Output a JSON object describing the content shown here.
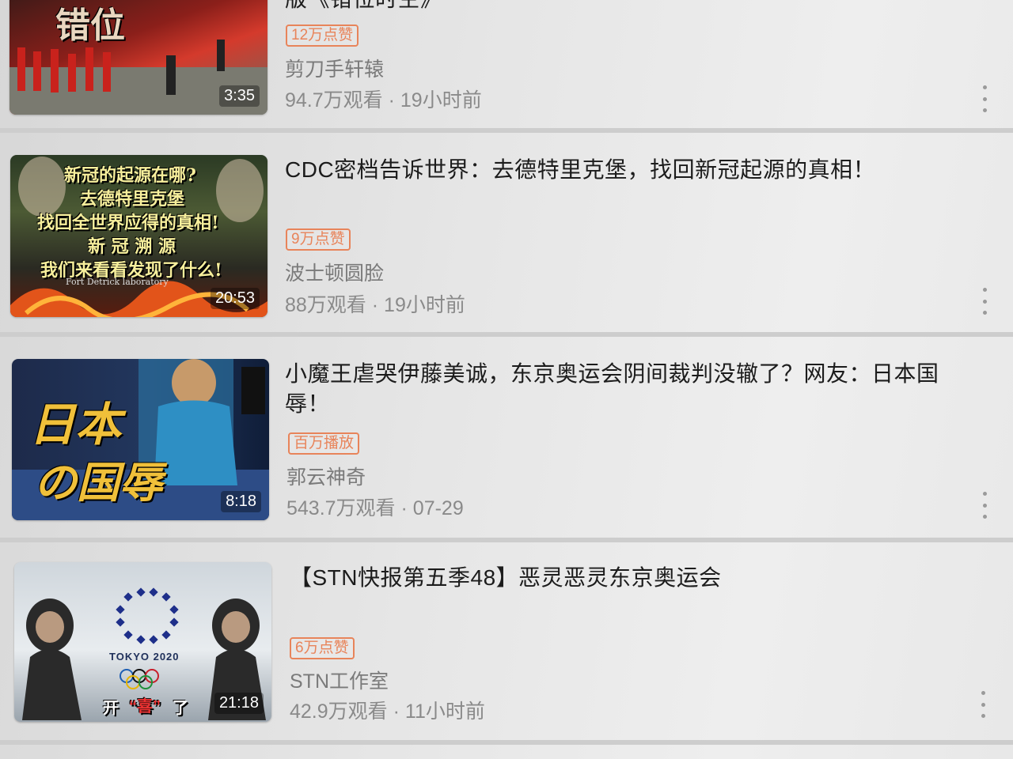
{
  "videos": [
    {
      "title": "版《错位时空》",
      "badge": "12万点赞",
      "author": "剪刀手轩辕",
      "views": "94.7万观看",
      "time": "19小时前",
      "duration": "3:35",
      "thumb_text": [
        "错位"
      ]
    },
    {
      "title": "CDC密档告诉世界：去德特里克堡，找回新冠起源的真相！",
      "badge": "9万点赞",
      "author": "波士顿圆脸",
      "views": "88万观看",
      "time": "19小时前",
      "duration": "20:53",
      "thumb_text": [
        "新冠的起源在哪?",
        "去德特里克堡",
        "找回全世界应得的真相!",
        "新 冠 溯 源",
        "我们来看看发现了什么!",
        "Fort Detrick laboratory"
      ]
    },
    {
      "title_line1": "小魔王虐哭伊藤美诚，东京奥运会阴间裁判没辙了？网友：日本国",
      "title_line2": "辱！",
      "badge": "百万播放",
      "author": "郭云神奇",
      "views": "543.7万观看",
      "time": "07-29",
      "duration": "8:18",
      "thumb_text": [
        "日本",
        "の国辱"
      ]
    },
    {
      "title": "【STN快报第五季48】恶灵恶灵东京奥运会",
      "badge": "6万点赞",
      "author": "STN工作室",
      "views": "42.9万观看",
      "time": "11小时前",
      "duration": "21:18",
      "thumb_text": [
        "TOKYO 2020",
        "开",
        "“喜”",
        "了"
      ]
    }
  ],
  "separator": "·",
  "icons": {
    "more": "more-vertical-icon"
  },
  "colors": {
    "badge": "#e8845a",
    "meta": "#8a8a8a"
  }
}
